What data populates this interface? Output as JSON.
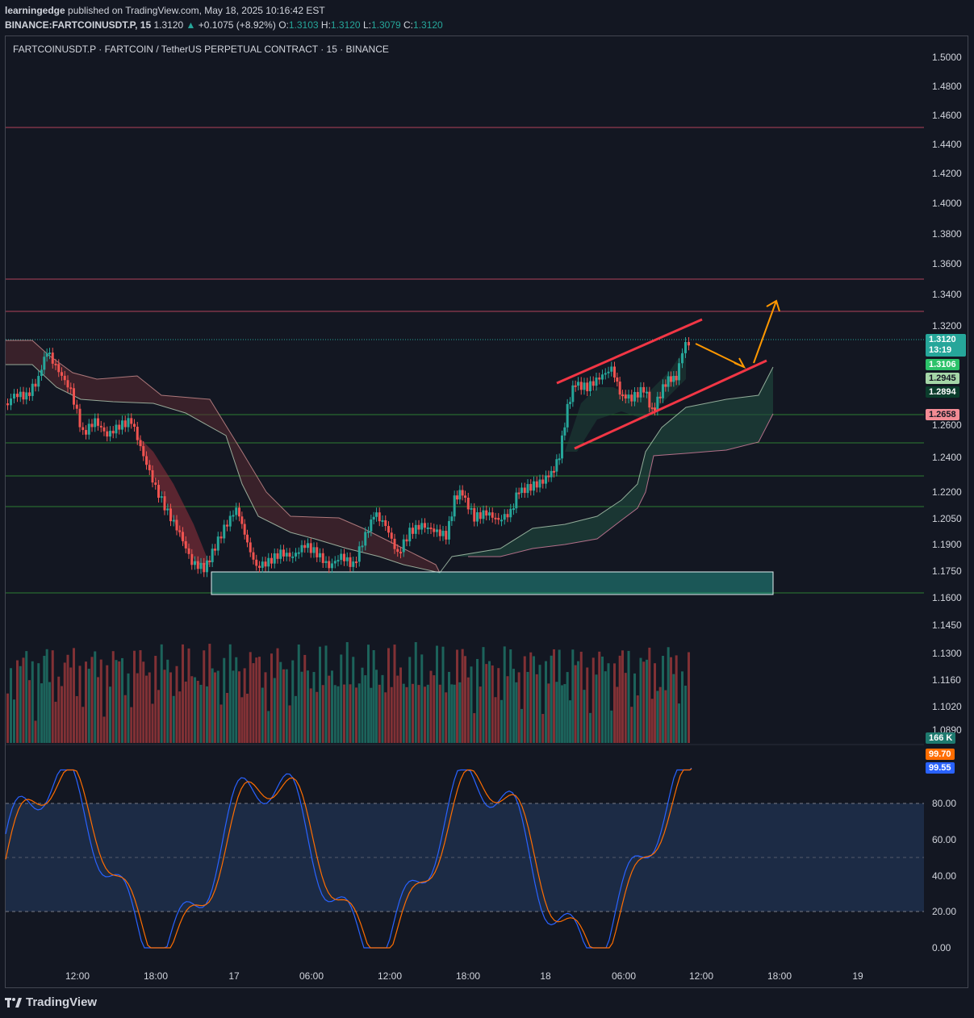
{
  "header": {
    "publisher": "learningedge",
    "published_text": "published on TradingView.com, May 18, 2025 10:16:42 EST",
    "symbol_line": "BINANCE:FARTCOINUSDT.P, 15",
    "last": "1.3120",
    "change": "+0.1075 (+8.92%)",
    "open_label": "O:",
    "open": "1.3103",
    "high_label": "H:",
    "high": "1.3120",
    "low_label": "L:",
    "low": "1.3079",
    "close_label": "C:",
    "close": "1.3120"
  },
  "chart_title": "FARTCOINUSDT.P · FARTCOIN / TetherUS PERPETUAL CONTRACT · 15 · BINANCE",
  "price_axis": [
    "1.5000",
    "1.4800",
    "1.4600",
    "1.4400",
    "1.4200",
    "1.4000",
    "1.3800",
    "1.3600",
    "1.3400",
    "1.3200",
    "1.2600",
    "1.2400",
    "1.2200",
    "1.2050",
    "1.1900",
    "1.1750",
    "1.1600",
    "1.1450",
    "1.1300",
    "1.1160",
    "1.1020",
    "1.0890"
  ],
  "osc_axis": [
    "80.00",
    "60.00",
    "40.00",
    "20.00",
    "0.00"
  ],
  "time_axis": [
    "12:00",
    "18:00",
    "17",
    "06:00",
    "12:00",
    "18:00",
    "18",
    "06:00",
    "12:00",
    "18:00",
    "19"
  ],
  "badges": {
    "price": "1.3120",
    "countdown": "13:19",
    "b2": "1.3106",
    "b3": "1.2945",
    "b4": "1.2894",
    "b5": "1.2658",
    "volume": "166 K",
    "stoch_k": "99.70",
    "stoch_d": "99.55"
  },
  "colors": {
    "up": "#26a69a",
    "down": "#ef5350",
    "channel": "#f23645",
    "arrow": "#ff9800",
    "zone": "#26a69a",
    "stoch_k": "#2962ff",
    "stoch_d": "#ff6d00",
    "osc_band": "#1c2b45"
  },
  "footer": {
    "brand": "TradingView"
  }
}
